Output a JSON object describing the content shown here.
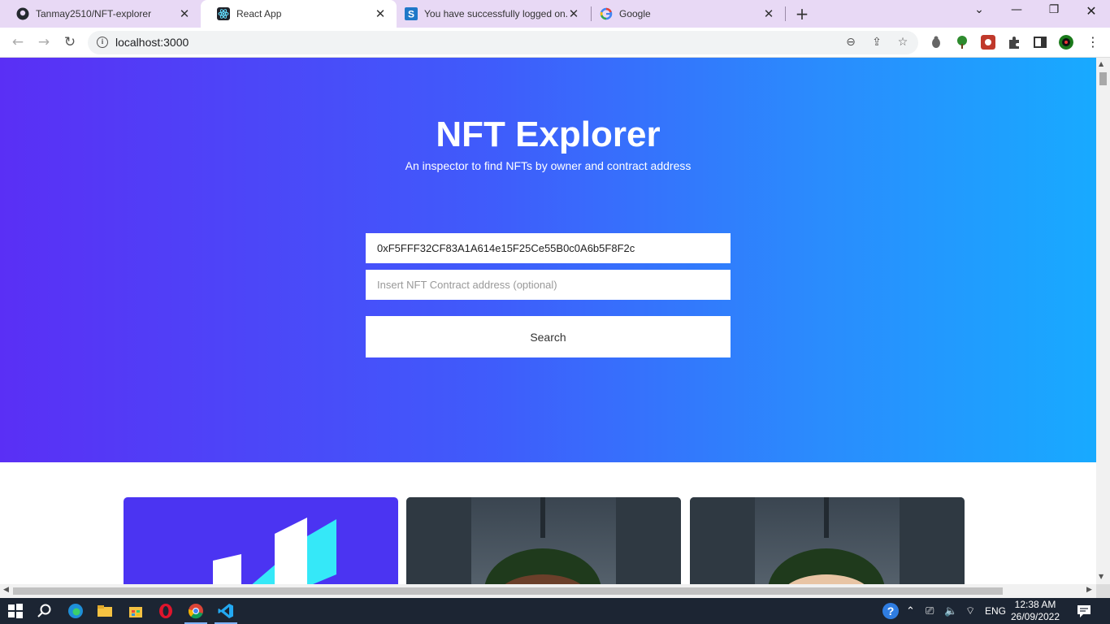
{
  "browser": {
    "tabs": [
      {
        "title": "Tanmay2510/NFT-explorer",
        "icon": "github-icon"
      },
      {
        "title": "React App",
        "icon": "react-icon"
      },
      {
        "title": "You have successfully logged on.",
        "icon": "s-app-icon"
      },
      {
        "title": "Google",
        "icon": "google-icon"
      }
    ],
    "active_tab": 1,
    "url": "localhost:3000"
  },
  "page": {
    "title": "NFT Explorer",
    "subtitle": "An inspector to find NFTs by owner and contract address",
    "wallet_input_value": "0xF5FFF32CF83A1A614e15F25Ce55B0c0A6b5F8F2c",
    "contract_input_placeholder": "Insert NFT Contract address (optional)",
    "search_label": "Search"
  },
  "taskbar": {
    "lang": "ENG",
    "time": "12:38 AM",
    "date": "26/09/2022"
  },
  "colors": {
    "hero_start": "#5a2ff5",
    "hero_end": "#18aaff",
    "tabstrip": "#e8d9f5"
  }
}
